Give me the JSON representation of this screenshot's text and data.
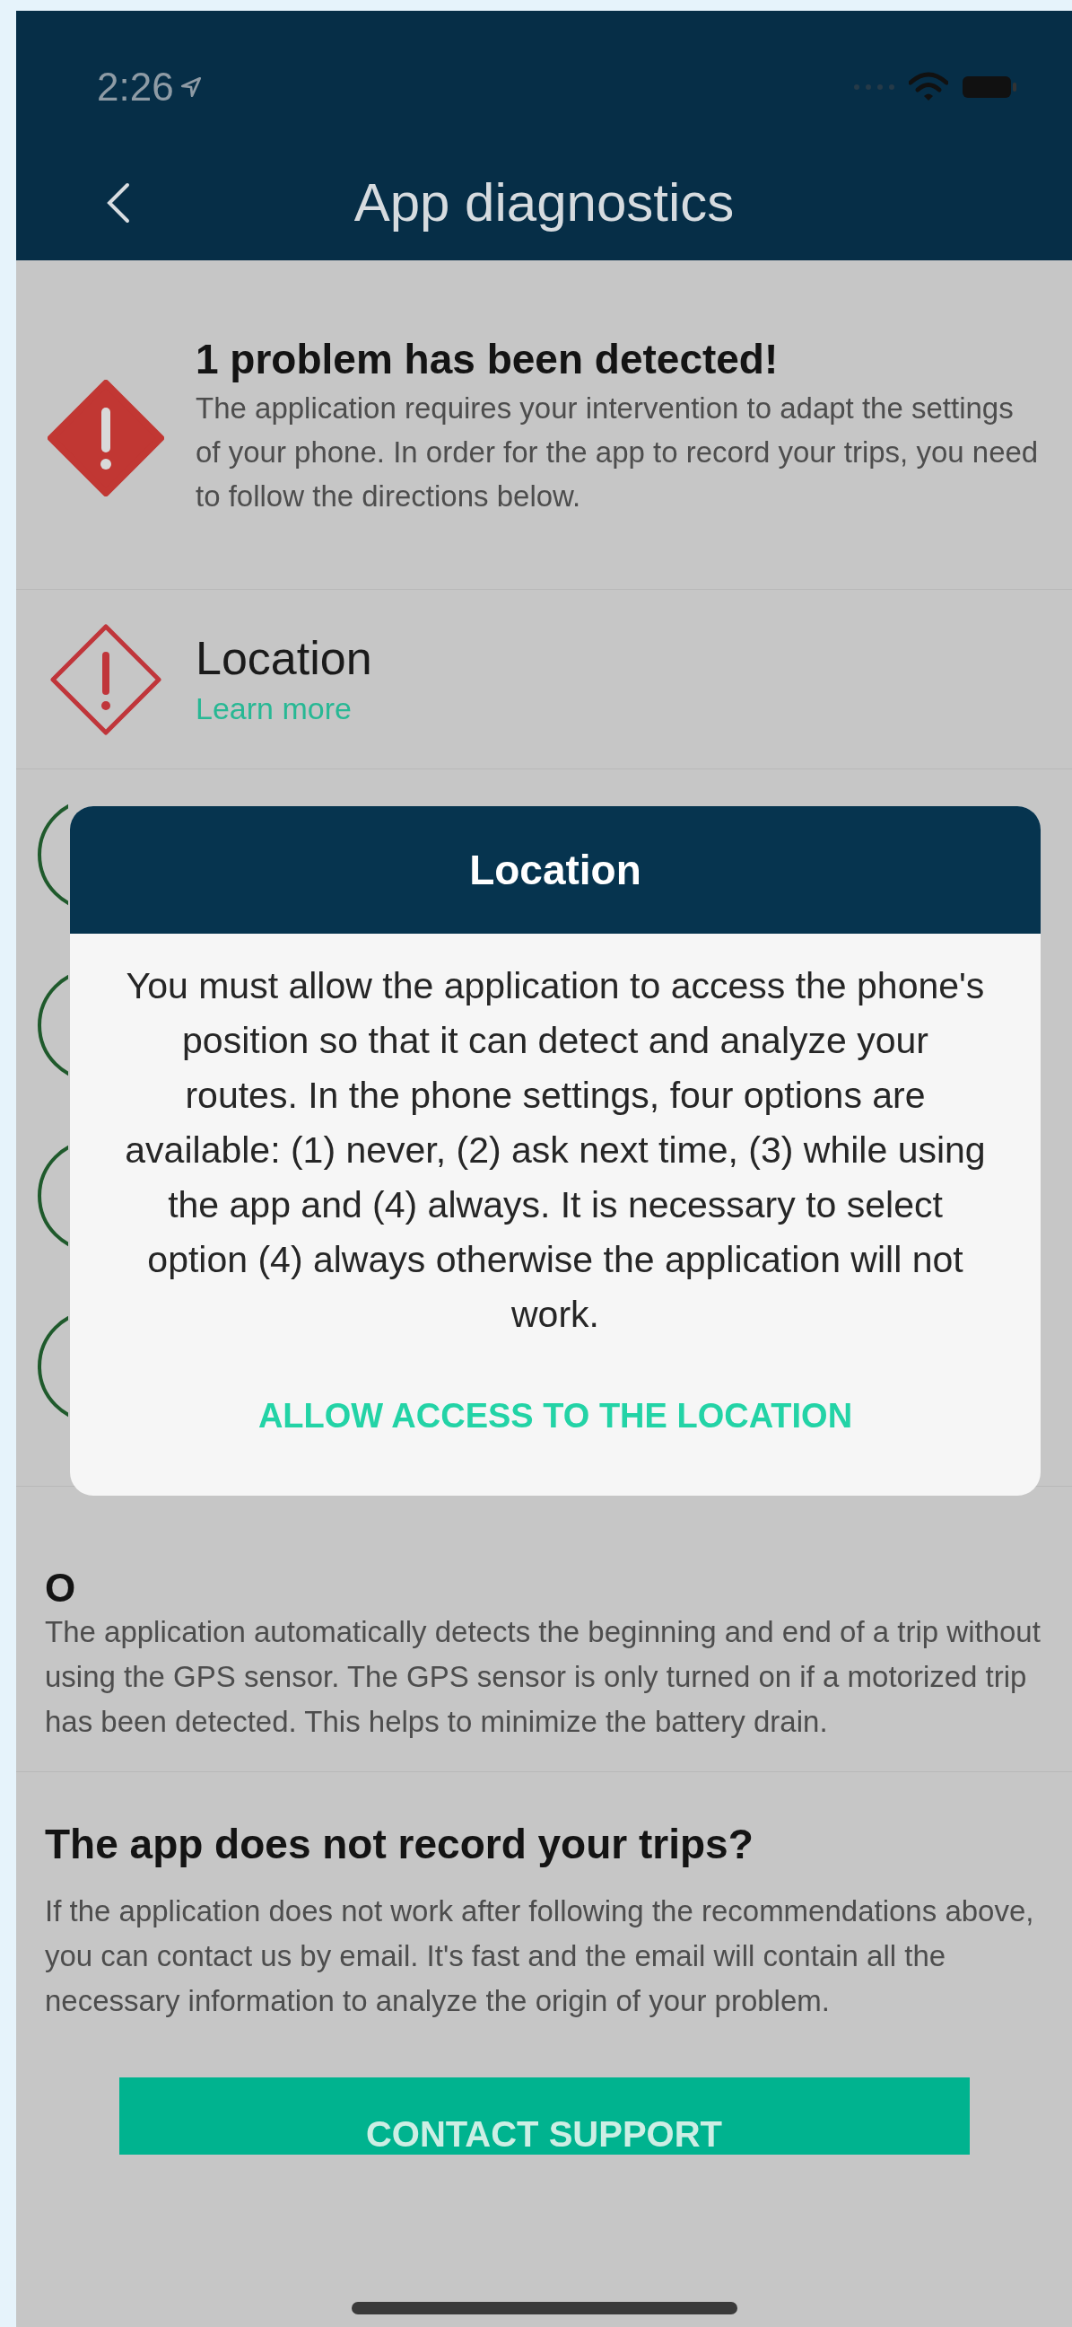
{
  "status_bar": {
    "time": "2:26"
  },
  "header": {
    "title": "App diagnostics"
  },
  "summary": {
    "title": "1 problem has been detected!",
    "text": "The application requires your intervention to adapt the settings of your phone. In order for the app to record your trips, you need to follow the directions below."
  },
  "checks": [
    {
      "kind": "problem",
      "title": "Location",
      "link": "Learn more"
    },
    {
      "kind": "ok"
    },
    {
      "kind": "ok"
    },
    {
      "kind": "ok"
    },
    {
      "kind": "ok"
    }
  ],
  "battery": {
    "title": "O",
    "text": "The application automatically detects the beginning and end of a trip without using the GPS sensor. The GPS sensor is only turned on if a motorized trip has been detected. This helps to minimize the battery drain."
  },
  "support": {
    "title": "The app does not record your trips?",
    "text": "If the application does not work after following the recommendations above, you can contact us by email. It's fast and the email will contain all the necessary information to analyze the origin of your problem.",
    "button": "CONTACT SUPPORT"
  },
  "dialog": {
    "title": "Location",
    "text": "You must allow the application to access the phone's position so that it can detect and analyze your routes. In the phone settings, four options are available: (1) never, (2) ask next time, (3) while using the app and (4) always. It is necessary to select option (4) always otherwise the application will not work.",
    "action": "ALLOW ACCESS TO THE LOCATION"
  }
}
